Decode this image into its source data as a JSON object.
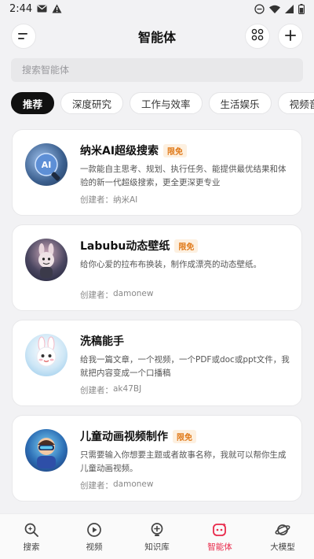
{
  "status_bar": {
    "time": "2:44",
    "icons": [
      "mail-icon",
      "warning-icon",
      "dnd-icon",
      "wifi-icon",
      "cellular-icon",
      "battery-icon"
    ]
  },
  "header": {
    "title": "智能体",
    "menu_icon": "menu-icon",
    "grid_icon": "grid-icon",
    "add_icon": "plus-icon"
  },
  "search": {
    "placeholder": "搜索智能体",
    "value": ""
  },
  "tabs": [
    {
      "label": "推荐",
      "active": true
    },
    {
      "label": "深度研究",
      "active": false
    },
    {
      "label": "工作与效率",
      "active": false
    },
    {
      "label": "生活娱乐",
      "active": false
    },
    {
      "label": "视频音",
      "active": false
    }
  ],
  "agents": [
    {
      "title": "纳米AI超级搜索",
      "badge": "限免",
      "description": "一款能自主思考、规划、执行任务、能提供最优结果和体验的新一代超级搜索，更全更深更专业",
      "creator_label": "创建者：",
      "creator": "纳米AI",
      "avatar_text": "AI"
    },
    {
      "title": "Labubu动态壁纸",
      "badge": "限免",
      "description": "给你心爱的拉布布换装，制作成漂亮的动态壁纸。",
      "creator_label": "创建者：",
      "creator": "damonew",
      "avatar_text": ""
    },
    {
      "title": "洗稿能手",
      "badge": "",
      "description": "给我一篇文章，一个视频，一个PDF或doc或ppt文件，我就把内容变成一个口播稿",
      "creator_label": "创建者：",
      "creator": "ak47BJ",
      "avatar_text": ""
    },
    {
      "title": "儿童动画视频制作",
      "badge": "限免",
      "description": "只需要输入你想要主题或者故事名称，我就可以帮你生成儿童动画视频。",
      "creator_label": "创建者：",
      "creator": "damonew",
      "avatar_text": ""
    }
  ],
  "bottom_nav": [
    {
      "label": "搜索",
      "icon": "search-sparkle-icon",
      "active": false
    },
    {
      "label": "视频",
      "icon": "video-play-icon",
      "active": false
    },
    {
      "label": "知识库",
      "icon": "knowledge-bulb-icon",
      "active": false
    },
    {
      "label": "智能体",
      "icon": "agent-bot-icon",
      "active": true
    },
    {
      "label": "大模型",
      "icon": "model-planet-icon",
      "active": false
    }
  ],
  "colors": {
    "accent": "#e8294a",
    "badge_text": "#e07a1a",
    "badge_bg": "#fdf0e0",
    "active_tab_bg": "#111111"
  }
}
